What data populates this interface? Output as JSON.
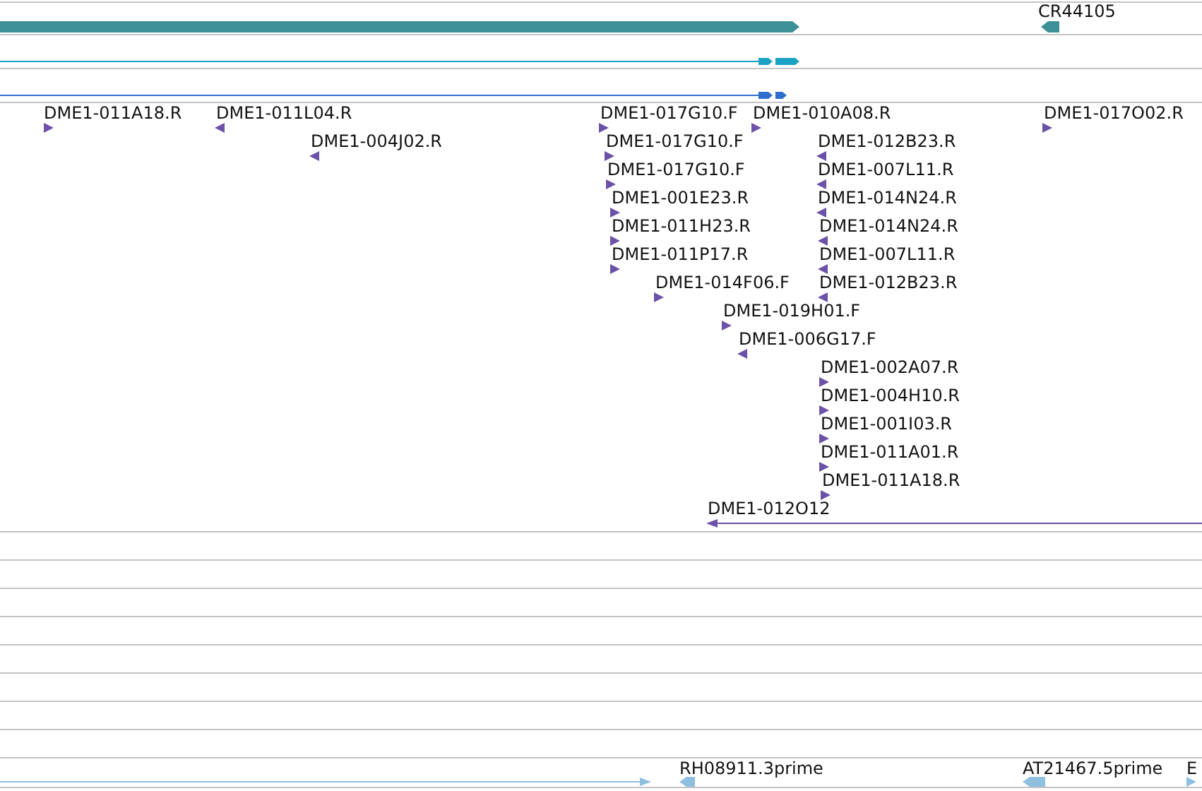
{
  "tracks": [
    {
      "kind": "gene",
      "color": "#3d9196",
      "features": [
        {
          "reverse": false
        },
        {
          "label": "CR44105",
          "reverse": true
        }
      ]
    },
    {
      "kind": "transcript",
      "color": "#1ba2c2",
      "features": [
        {
          "reverse": false
        }
      ]
    },
    {
      "kind": "transcript",
      "color": "#2d6dcc",
      "features": [
        {
          "reverse": false
        }
      ]
    },
    {
      "kind": "clone_ends",
      "color": "#6b52a8",
      "features": [
        {
          "label": "DME1-011A18.R",
          "reverse": false
        },
        {
          "label": "DME1-011L04.R",
          "reverse": true
        },
        {
          "label": "DME1-017G10.F",
          "reverse": false
        },
        {
          "label": "DME1-010A08.R",
          "reverse": false
        },
        {
          "label": "DME1-017O02.R",
          "reverse": false
        },
        {
          "label": "DME1-004J02.R",
          "reverse": true
        },
        {
          "label": "DME1-017G10.F",
          "reverse": false
        },
        {
          "label": "DME1-012B23.R",
          "reverse": true
        },
        {
          "label": "DME1-017G10.F",
          "reverse": false
        },
        {
          "label": "DME1-007L11.R",
          "reverse": true
        },
        {
          "label": "DME1-001E23.R",
          "reverse": false
        },
        {
          "label": "DME1-014N24.R",
          "reverse": true
        },
        {
          "label": "DME1-011H23.R",
          "reverse": false
        },
        {
          "label": "DME1-014N24.R",
          "reverse": true
        },
        {
          "label": "DME1-011P17.R",
          "reverse": false
        },
        {
          "label": "DME1-007L11.R",
          "reverse": true
        },
        {
          "label": "DME1-014F06.F",
          "reverse": false
        },
        {
          "label": "DME1-012B23.R",
          "reverse": true
        },
        {
          "label": "DME1-019H01.F",
          "reverse": false
        },
        {
          "label": "DME1-006G17.F",
          "reverse": true
        },
        {
          "label": "DME1-002A07.R",
          "reverse": false
        },
        {
          "label": "DME1-004H10.R",
          "reverse": false
        },
        {
          "label": "DME1-001I03.R",
          "reverse": false
        },
        {
          "label": "DME1-011A01.R",
          "reverse": false
        },
        {
          "label": "DME1-011A18.R",
          "reverse": false
        },
        {
          "label": "DME1-012O12",
          "reverse": true
        }
      ]
    },
    {
      "kind": "est",
      "color": "#8fbfdf",
      "features": [
        {
          "reverse": false
        },
        {
          "label": "RH08911.3prime",
          "reverse": true
        },
        {
          "label": "AT21467.5prime",
          "reverse": true
        },
        {
          "label": "E",
          "reverse": false
        }
      ]
    }
  ]
}
